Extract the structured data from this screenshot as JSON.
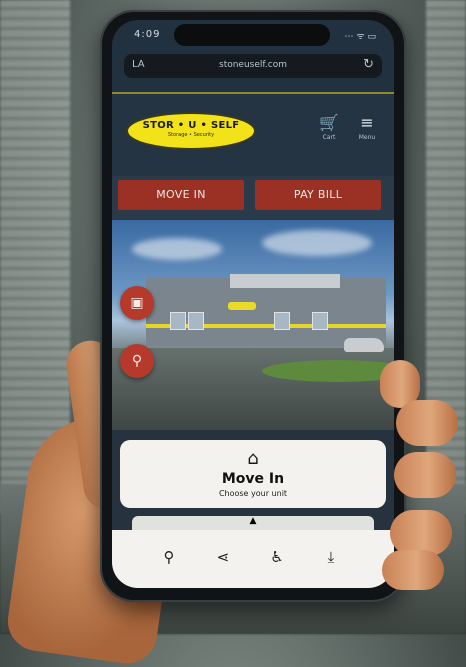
{
  "status": {
    "time": "4:09",
    "icons": "⋯ ᯤ ▭"
  },
  "browser": {
    "left_label": "LA",
    "url": "stoneuself.com",
    "reload_glyph": "↻"
  },
  "header": {
    "logo_text": "STOR • U • SELF",
    "logo_sub": "Storage • Security",
    "cart_label": "Cart",
    "menu_label": "Menu"
  },
  "buttons": {
    "move_in": "MOVE IN",
    "pay_bill": "PAY BILL"
  },
  "card": {
    "title": "Move In",
    "subtitle": "Choose your unit"
  },
  "colors": {
    "accent_red": "#9b3124",
    "brand_yellow": "#f1e21a",
    "header_bg": "#243443"
  }
}
